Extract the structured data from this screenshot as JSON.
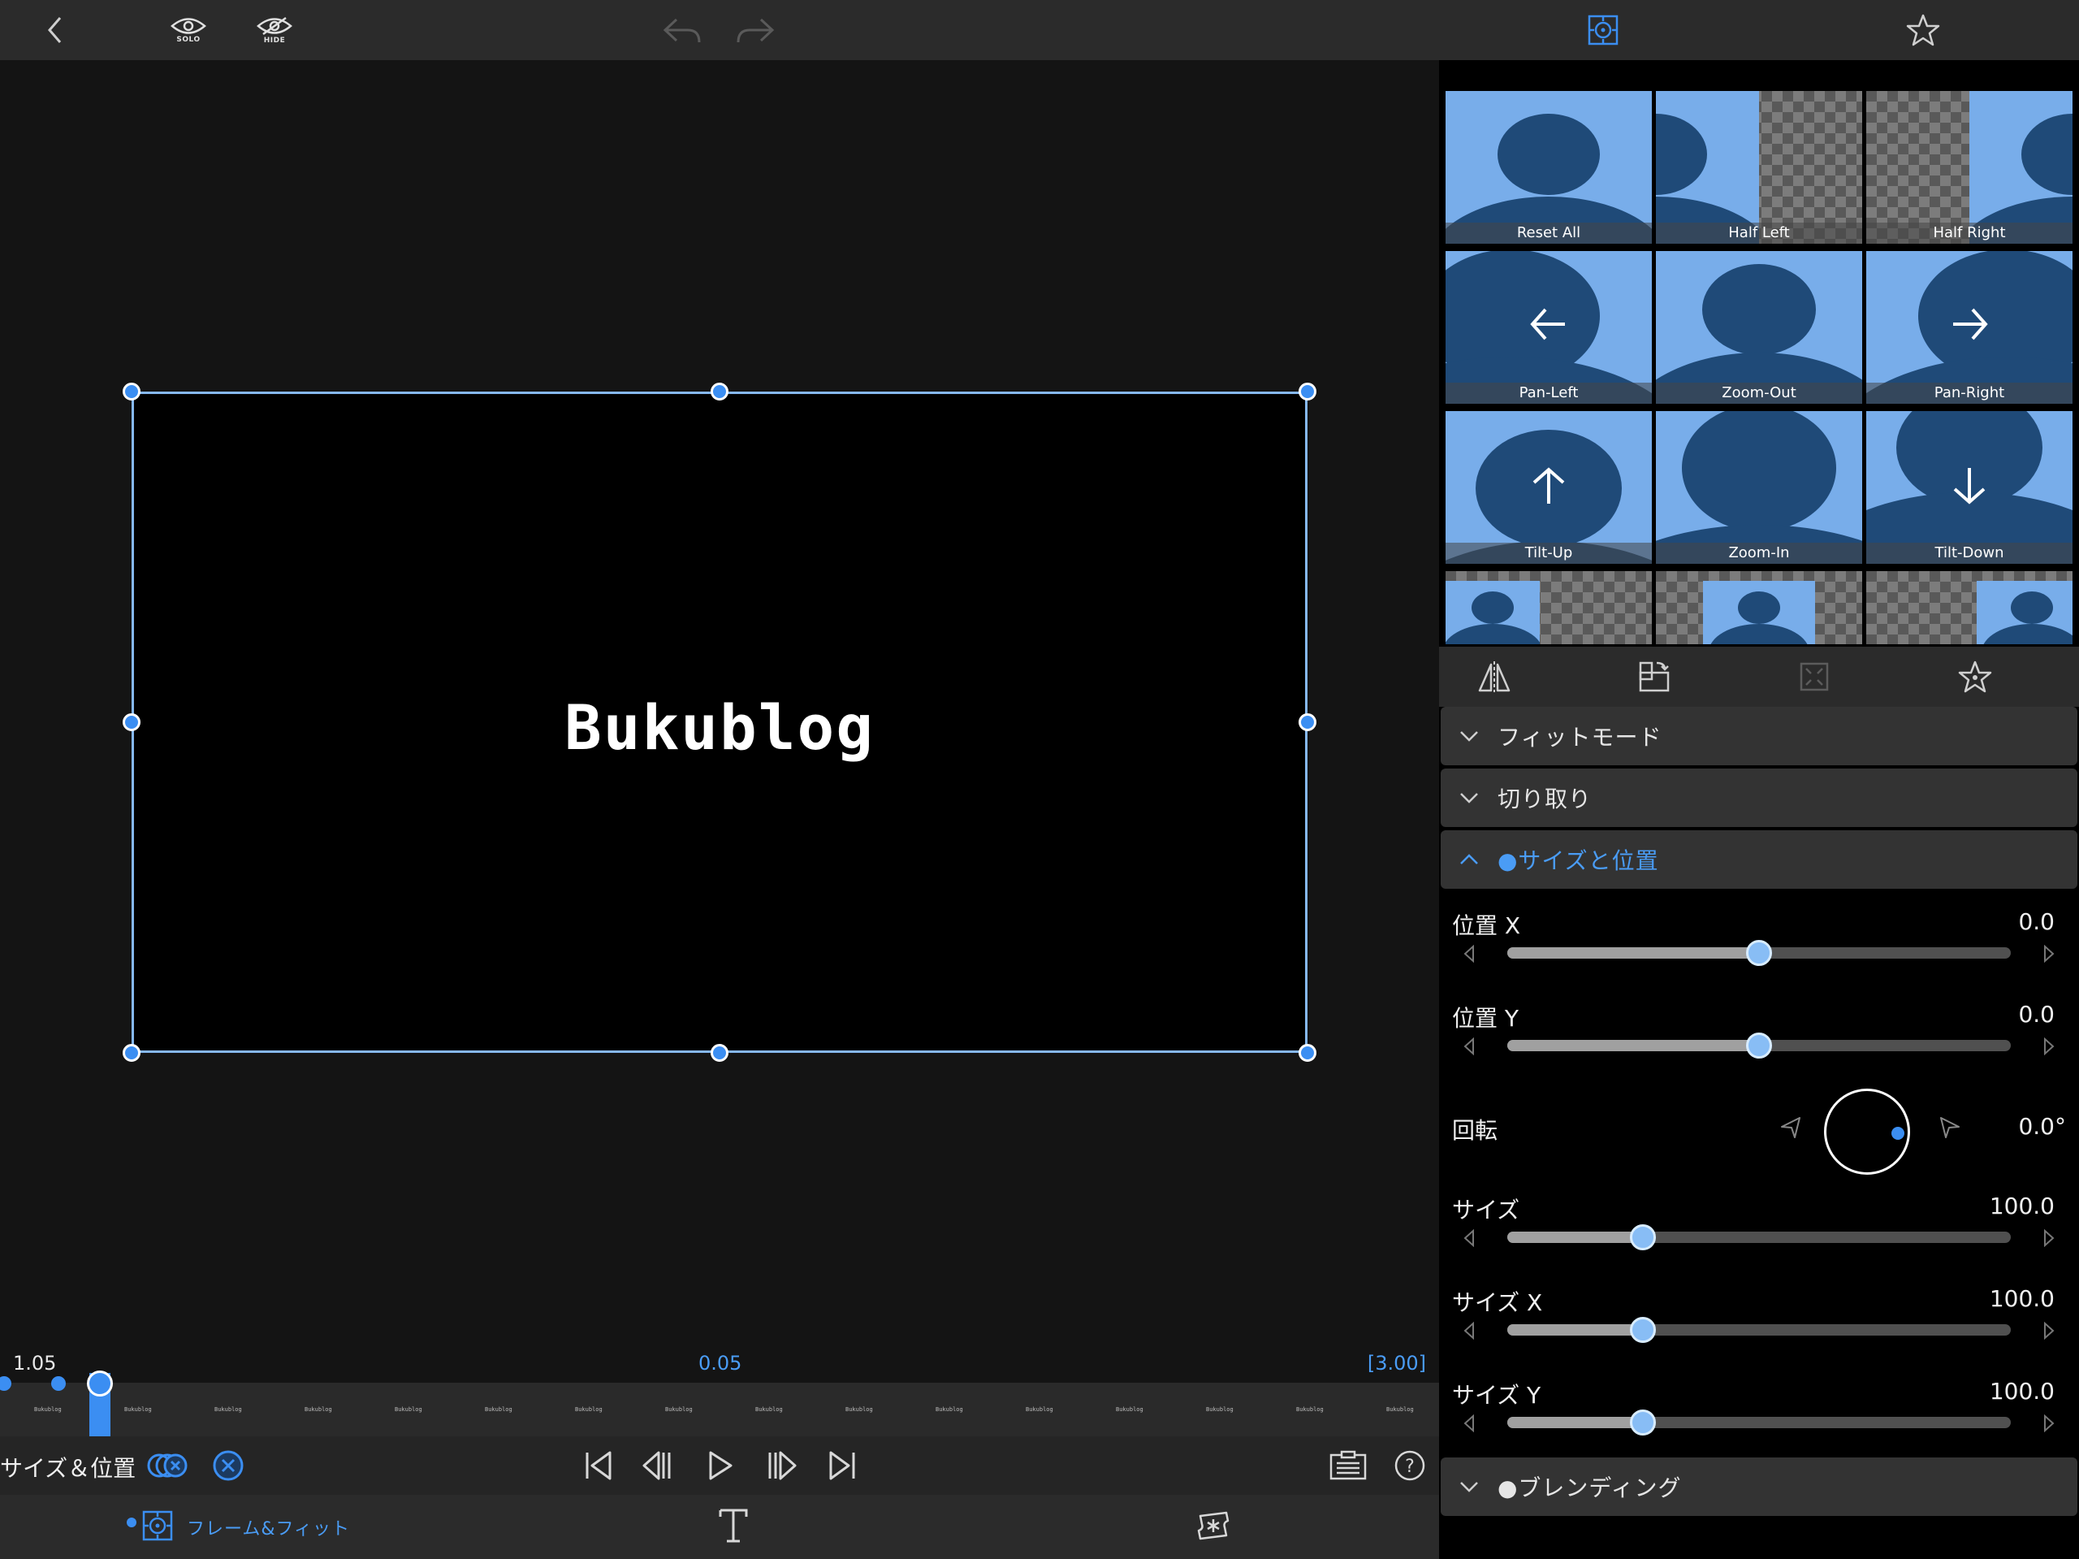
{
  "topbar": {
    "solo_label": "SOLO",
    "hide_label": "HIDE"
  },
  "canvas": {
    "text": "Bukublog"
  },
  "timeline": {
    "left_time": "1.05",
    "center_time": "0.05",
    "right_time": "[3.00]",
    "thumb_label": "Bukublog"
  },
  "controls": {
    "mode_label": "サイズ＆位置"
  },
  "bottombar": {
    "frame_fit_label": "フレーム&フィット"
  },
  "presets": [
    {
      "label": "Reset All"
    },
    {
      "label": "Half Left"
    },
    {
      "label": "Half Right"
    },
    {
      "label": "Pan-Left"
    },
    {
      "label": "Zoom-Out"
    },
    {
      "label": "Pan-Right"
    },
    {
      "label": "Tilt-Up"
    },
    {
      "label": "Zoom-In"
    },
    {
      "label": "Tilt-Down"
    }
  ],
  "sections": {
    "fit_mode": "フィットモード",
    "crop": "切り取り",
    "size_position": "●サイズと位置",
    "blending": "●ブレンディング"
  },
  "params": {
    "pos_x": {
      "label": "位置 X",
      "value": "0.0",
      "level": 0.5
    },
    "pos_y": {
      "label": "位置 Y",
      "value": "0.0",
      "level": 0.5
    },
    "rotation": {
      "label": "回転",
      "value": "0.0°"
    },
    "size": {
      "label": "サイズ",
      "value": "100.0",
      "level": 0.27
    },
    "size_x": {
      "label": "サイズ X",
      "value": "100.0",
      "level": 0.27
    },
    "size_y": {
      "label": "サイズ Y",
      "value": "100.0",
      "level": 0.27
    }
  },
  "colors": {
    "accent": "#3b8ef2",
    "preset_light": "#78adea",
    "preset_dark": "#1f4a78"
  }
}
